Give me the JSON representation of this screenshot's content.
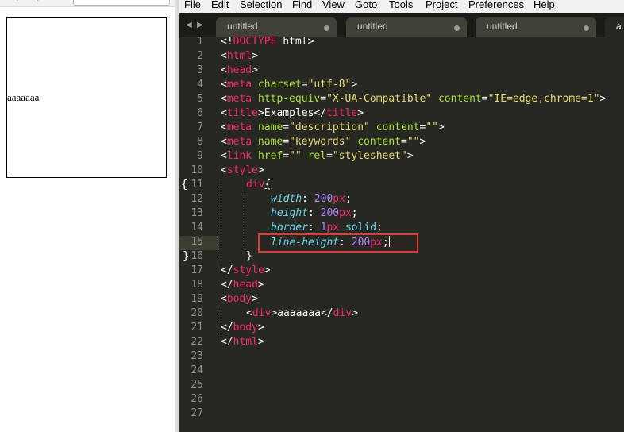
{
  "browser": {
    "nav_back": "←",
    "nav_forward": "→",
    "div_text": "aaaaaaa"
  },
  "editor": {
    "menu": [
      "File",
      "Edit",
      "Selection",
      "Find",
      "View",
      "Goto",
      "Tools",
      "Project",
      "Preferences",
      "Help"
    ],
    "tabs": [
      {
        "label": "untitled"
      },
      {
        "label": "untitled"
      },
      {
        "label": "untitled"
      },
      {
        "label": "a."
      }
    ],
    "line_numbers": [
      "1",
      "2",
      "3",
      "4",
      "5",
      "6",
      "7",
      "8",
      "9",
      "10",
      "11",
      "12",
      "13",
      "14",
      "15",
      "16",
      "17",
      "18",
      "19",
      "20",
      "21",
      "22",
      "23",
      "24",
      "25",
      "26",
      "27"
    ],
    "fold_open": "{",
    "fold_close": "}",
    "highlighted_line": "15",
    "code": {
      "l1": [
        "<!",
        "DOCTYPE",
        " html>"
      ],
      "l2": [
        "<",
        "html",
        ">"
      ],
      "l3": [
        "<",
        "head",
        ">"
      ],
      "l4": [
        "<",
        "meta",
        " ",
        "charset",
        "=",
        "\"utf-8\"",
        ">"
      ],
      "l5": [
        "<",
        "meta",
        " ",
        "http-equiv",
        "=",
        "\"X-UA-Compatible\"",
        " ",
        "content",
        "=",
        "\"IE=edge,chrome=1\"",
        ">"
      ],
      "l6": [
        "<",
        "title",
        ">",
        "Examples",
        "</",
        "title",
        ">"
      ],
      "l7": [
        "<",
        "meta",
        " ",
        "name",
        "=",
        "\"description\"",
        " ",
        "content",
        "=",
        "\"\"",
        ">"
      ],
      "l8": [
        "<",
        "meta",
        " ",
        "name",
        "=",
        "\"keywords\"",
        " ",
        "content",
        "=",
        "\"\"",
        ">"
      ],
      "l9": [
        "<",
        "link",
        " ",
        "href",
        "=",
        "\"\"",
        " ",
        "rel",
        "=",
        "\"stylesheet\"",
        ">"
      ],
      "l10": [
        "<",
        "style",
        ">"
      ],
      "l11": [
        "div",
        "{"
      ],
      "l12": [
        "width",
        ": ",
        "200",
        "px",
        ";"
      ],
      "l13": [
        "height",
        ": ",
        "200",
        "px",
        ";"
      ],
      "l14": [
        "border",
        ": ",
        "1",
        "px",
        " ",
        "solid",
        ";"
      ],
      "l15": [
        "line-height",
        ": ",
        "200",
        "px",
        ";"
      ],
      "l16": [
        "}"
      ],
      "l17": [
        "</",
        "style",
        ">"
      ],
      "l18": [
        "</",
        "head",
        ">"
      ],
      "l19": [
        "<",
        "body",
        ">"
      ],
      "l20": [
        "<",
        "div",
        ">",
        "aaaaaaa",
        "</",
        "div",
        ">"
      ],
      "l21": [
        "</",
        "body",
        ">"
      ],
      "l22": [
        "</",
        "html",
        ">"
      ]
    }
  },
  "colors": {
    "editor_bg": "#272822",
    "tag": "#f92672",
    "attribute": "#a6e22e",
    "string": "#e6db74",
    "property": "#66d9ef",
    "number": "#ae81ff",
    "highlight_box": "#e53935"
  }
}
